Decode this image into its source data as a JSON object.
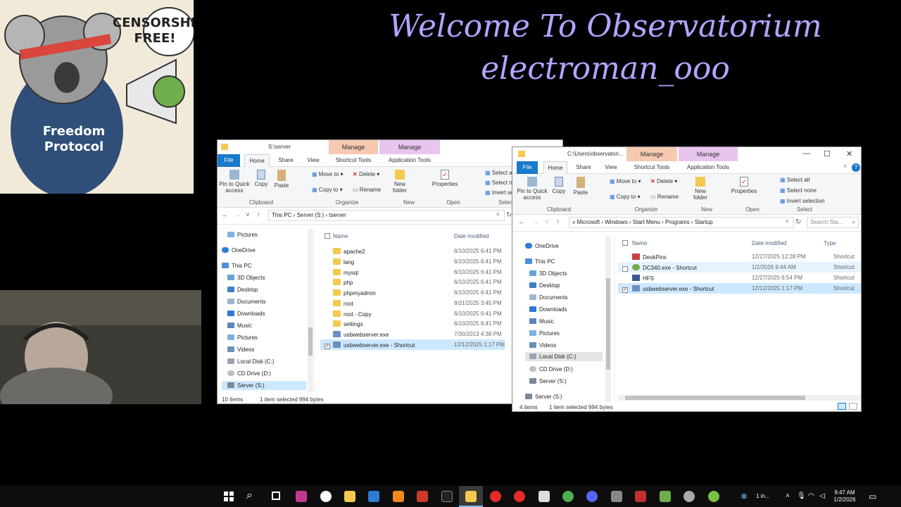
{
  "overlay": {
    "welcome_line1": "Welcome To Observatorium",
    "welcome_line2": "electroman_ooo",
    "koala_bubble": "CENSORSHIP FREE!",
    "koala_shirt": "Freedom Protocol"
  },
  "left_window": {
    "path_title": "S:\\server",
    "ctx_manage1": "Manage",
    "ctx_manage2": "Manage",
    "ctx_tools1": "Shortcut Tools",
    "ctx_tools2": "Application Tools",
    "tabs": {
      "file": "File",
      "home": "Home",
      "share": "Share",
      "view": "View"
    },
    "ribbon": {
      "pin": "Pin to Quick access",
      "copy": "Copy",
      "paste": "Paste",
      "move_to": "Move to",
      "delete": "Delete",
      "copy_to": "Copy to",
      "rename": "Rename",
      "new_folder": "New folder",
      "properties": "Properties",
      "select_all": "Select all",
      "select_none": "Select n",
      "invert": "Invert se",
      "grp_clipboard": "Clipboard",
      "grp_organize": "Organize",
      "grp_new": "New",
      "grp_open": "Open",
      "grp_select": "Selec"
    },
    "breadcrumb": [
      "This PC",
      "Server (S:)",
      "tserver"
    ],
    "nav": [
      "Pictures",
      "OneDrive",
      "This PC",
      "3D Objects",
      "Desktop",
      "Documents",
      "Downloads",
      "Music",
      "Pictures",
      "Videos",
      "Local Disk (C:)",
      "CD Drive (D:)",
      "Server (S:)"
    ],
    "col_name": "Name",
    "col_date": "Date modified",
    "files": [
      {
        "name": "apache2",
        "date": "6/10/2025 6:41 PM",
        "type": "folder"
      },
      {
        "name": "lang",
        "date": "6/10/2025 6:41 PM",
        "type": "folder"
      },
      {
        "name": "mysql",
        "date": "6/10/2025 6:41 PM",
        "type": "folder"
      },
      {
        "name": "php",
        "date": "6/10/2025 6:41 PM",
        "type": "folder"
      },
      {
        "name": "phpmyadmin",
        "date": "6/10/2025 6:41 PM",
        "type": "folder"
      },
      {
        "name": "root",
        "date": "8/31/2025 3:45 PM",
        "type": "folder"
      },
      {
        "name": "root - Copy",
        "date": "6/10/2025 6:41 PM",
        "type": "folder"
      },
      {
        "name": "settings",
        "date": "6/10/2025 6:41 PM",
        "type": "folder"
      },
      {
        "name": "usbwebserver.exe",
        "date": "7/30/2013 4:38 PM",
        "type": "exe"
      },
      {
        "name": "usbwebserver.exe - Shortcut",
        "date": "12/12/2025 1:17 PM",
        "type": "exe",
        "selected": true
      }
    ],
    "status_count": "10 items",
    "status_selected": "1 item selected  994 bytes"
  },
  "right_window": {
    "path_title": "C:\\Users\\observatori...",
    "ctx_manage1": "Manage",
    "ctx_manage2": "Manage",
    "ctx_tools1": "Shortcut Tools",
    "ctx_tools2": "Application Tools",
    "tabs": {
      "file": "File",
      "home": "Home",
      "share": "Share",
      "view": "View"
    },
    "ribbon": {
      "pin": "Pin to Quick access",
      "copy": "Copy",
      "paste": "Paste",
      "move_to": "Move to",
      "delete": "Delete",
      "copy_to": "Copy to",
      "rename": "Rename",
      "new_folder": "New folder",
      "properties": "Properties",
      "select_all": "Select all",
      "select_none": "Select none",
      "invert": "Invert selection",
      "grp_clipboard": "Clipboard",
      "grp_organize": "Organize",
      "grp_new": "New",
      "grp_open": "Open",
      "grp_select": "Select"
    },
    "breadcrumb": [
      "Microsoft",
      "Windows",
      "Start Menu",
      "Programs",
      "Startup"
    ],
    "search_placeholder": "Search Sta...",
    "nav": [
      "OneDrive",
      "This PC",
      "3D Objects",
      "Desktop",
      "Documents",
      "Downloads",
      "Music",
      "Pictures",
      "Videos",
      "Local Disk (C:)",
      "CD Drive (D:)",
      "Server (S:)",
      "Server (S:)"
    ],
    "col_name": "Name",
    "col_date": "Date modified",
    "col_type": "Type",
    "files": [
      {
        "name": "DeskPins",
        "date": "12/27/2025 12:28 PM",
        "type": "Shortcut"
      },
      {
        "name": "DC340.exe - Shortcut",
        "date": "1/2/2026 9:44 AM",
        "type": "Shortcut"
      },
      {
        "name": "HFS",
        "date": "12/27/2025 6:54 PM",
        "type": "Shortcut"
      },
      {
        "name": "usbwebserver.exe - Shortcut",
        "date": "12/12/2025 1:17 PM",
        "type": "Shortcut",
        "selected": true
      }
    ],
    "status_count": "4 items",
    "status_selected": "1 item selected  994 bytes"
  },
  "taskbar": {
    "tray_label": "1 in...",
    "time": "9:47 AM",
    "date": "1/2/2026"
  }
}
